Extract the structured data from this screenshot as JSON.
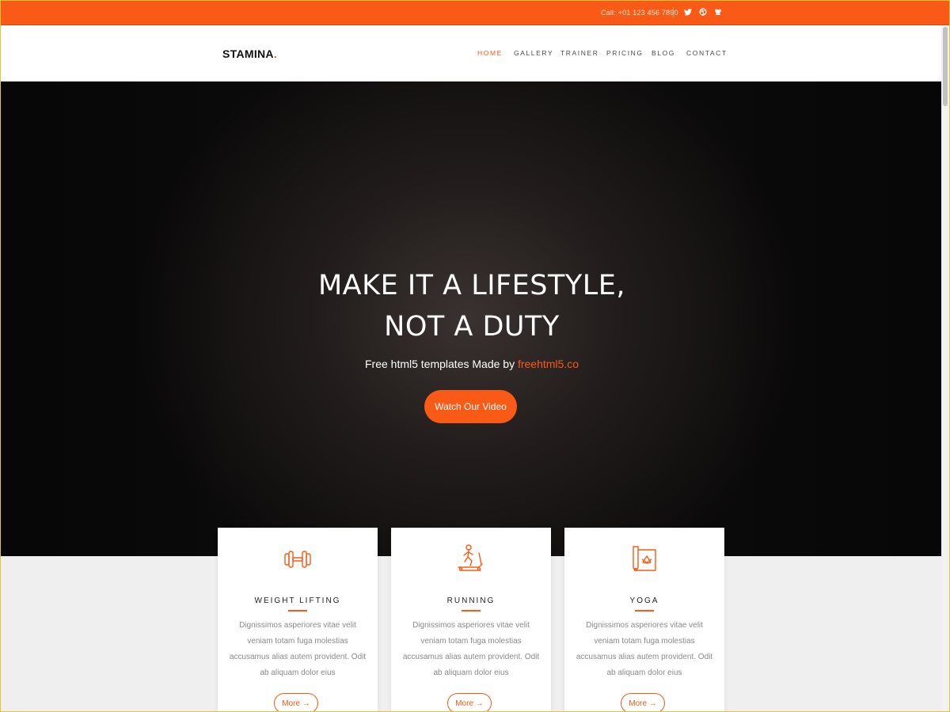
{
  "colors": {
    "accent": "#f95a16",
    "dark": "#111111"
  },
  "topbar": {
    "call": "Call: +01 123 456 7890",
    "social": [
      {
        "icon": "twitter-icon"
      },
      {
        "icon": "dribbble-icon"
      },
      {
        "icon": "github-icon"
      }
    ]
  },
  "header": {
    "logo": "STAMINA",
    "logo_dot": ".",
    "nav": [
      {
        "label": "HOME",
        "active": true
      },
      {
        "label": "GALLERY"
      },
      {
        "label": "TRAINER"
      },
      {
        "label": "PRICING"
      },
      {
        "label": "BLOG"
      },
      {
        "label": "CONTACT"
      }
    ]
  },
  "hero": {
    "title_line1": "MAKE IT A LIFESTYLE,",
    "title_line2": "NOT A DUTY",
    "subtitle_prefix": "Free html5 templates Made by ",
    "subtitle_link": "freehtml5.co",
    "button": "Watch Our Video"
  },
  "cards": [
    {
      "icon": "dumbbell-icon",
      "title": "WEIGHT LIFTING",
      "text": "Dignissimos asperiores vitae velit veniam totam fuga molestias accusamus alias autem provident. Odit ab aliquam dolor eius",
      "button": "More →"
    },
    {
      "icon": "treadmill-runner-icon",
      "title": "RUNNING",
      "text": "Dignissimos asperiores vitae velit veniam totam fuga molestias accusamus alias autem provident. Odit ab aliquam dolor eius",
      "button": "More →"
    },
    {
      "icon": "yoga-mat-icon",
      "title": "YOGA",
      "text": "Dignissimos asperiores vitae velit veniam totam fuga molestias accusamus alias autem provident. Odit ab aliquam dolor eius",
      "button": "More →"
    }
  ]
}
